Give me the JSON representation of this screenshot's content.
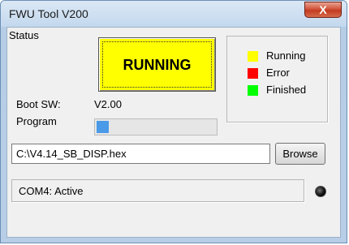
{
  "window": {
    "title": "FWU Tool V200",
    "close_glyph": "X"
  },
  "run_button": {
    "label": "RUNNING",
    "color": "#ffff00"
  },
  "status_legend": {
    "title": "Status",
    "items": [
      {
        "label": "Running",
        "color": "#ffff00"
      },
      {
        "label": "Error",
        "color": "#ff0000"
      },
      {
        "label": "Finished",
        "color": "#00ff00"
      }
    ]
  },
  "boot": {
    "label": "Boot SW:",
    "value": "V2.00"
  },
  "program": {
    "label": "Program",
    "progress_fraction": 0.1,
    "color": "#4a9ae8"
  },
  "file": {
    "path": "C:\\V4.14_SB_DISP.hex",
    "browse_label": "Browse"
  },
  "status_bar": {
    "text": "COM4: Active",
    "led_icon": "led-indicator-icon"
  }
}
